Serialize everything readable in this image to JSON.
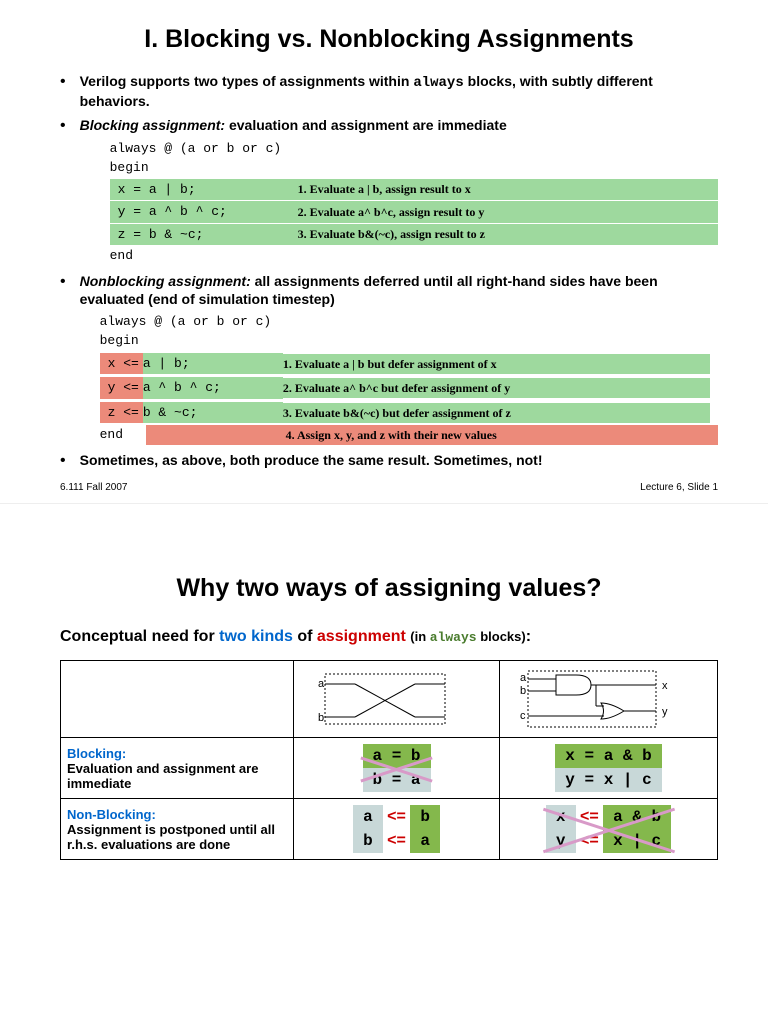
{
  "slide1": {
    "title": "I. Blocking vs. Nonblocking Assignments",
    "bullet1_a": "Verilog supports two types of assignments within ",
    "bullet1_code": "always",
    "bullet1_b": " blocks, with subtly different behaviors.",
    "bullet2_a": "Blocking assignment:",
    "bullet2_b": " evaluation and assignment are immediate",
    "code1_l1": "always @ (a or b or c)",
    "code1_l2": "begin",
    "code1_end": "end",
    "code1_r1_code": "x = a | b;",
    "code1_r1_desc": "1. Evaluate a | b, assign result to x",
    "code1_r2_code": "y = a ^ b ^ c;",
    "code1_r2_desc": "2. Evaluate a^ b^c, assign result to y",
    "code1_r3_code": "z = b & ~c;",
    "code1_r3_desc": "3. Evaluate b&(~c), assign result to z",
    "bullet3_a": "Nonblocking assignment:",
    "bullet3_b": " all assignments deferred until all right-hand sides have been evaluated (end of simulation timestep)",
    "code2_l1": "always @ (a or b or c)",
    "code2_l2": "begin",
    "code2_end": "end",
    "code2_r1_l": "x <=",
    "code2_r1_r": " a | b;",
    "code2_r1_desc": "1. Evaluate a | b but defer assignment of x",
    "code2_r2_l": "y <=",
    "code2_r2_r": " a ^ b ^ c;",
    "code2_r2_desc": "2. Evaluate a^ b^c  but defer assignment of y",
    "code2_r3_l": "z <=",
    "code2_r3_r": " b & ~c;",
    "code2_r3_desc": "3. Evaluate b&(~c) but defer assignment of z",
    "code2_r4_desc": "4. Assign x, y, and z with their new values",
    "bullet4": "Sometimes, as above, both produce the same result. Sometimes, not!",
    "footer_left": "6.111 Fall 2007",
    "footer_right": "Lecture 6, Slide 1"
  },
  "slide2": {
    "title": "Why two ways of assigning values?",
    "line_a": "Conceptual need for ",
    "line_b": "two kinds",
    "line_c": " of ",
    "line_d": "assignment",
    "line_e": "(in ",
    "line_f": "always",
    "line_g": " blocks)",
    "row2_label_a": "Blocking:",
    "row2_label_b": "Evaluation and assignment are immediate",
    "row3_label_a": "Non-Blocking:",
    "row3_label_b": "Assignment is postponed until all r.h.s. evaluations are done",
    "eq_ab": "a = b",
    "eq_ba": "b = a",
    "eq_xab": "x = a & b",
    "eq_yxc": "y = x | c",
    "eq_ab2": "a",
    "eq_le": "<=",
    "eq_b2": "b",
    "eq_b3": "b",
    "eq_a3": "a",
    "eq_x2": "x",
    "eq_rhs_ab": "a & b",
    "eq_y2": "y",
    "eq_rhs_xc": "x | c",
    "diag_a": "a",
    "diag_b": "b",
    "diag_c": "c",
    "diag_x": "x",
    "diag_y": "y"
  }
}
